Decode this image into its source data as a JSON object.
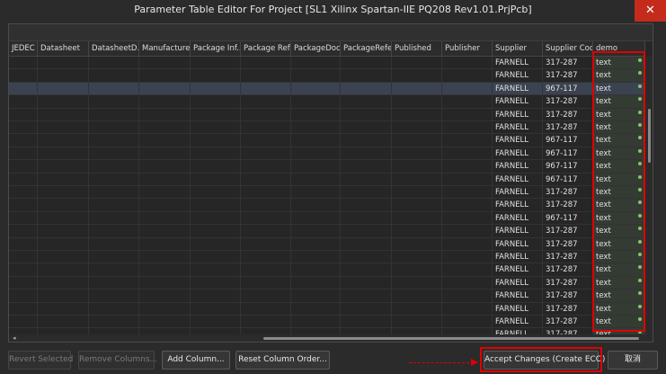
{
  "window": {
    "title": "Parameter Table Editor For Project [SL1 Xilinx Spartan-IIE PQ208 Rev1.01.PrjPcb]",
    "close_glyph": "✕"
  },
  "table": {
    "columns": [
      "JEDEC",
      "Datasheet",
      "DatasheetD...",
      "Manufacturer",
      "Package Inf...",
      "Package Ref...",
      "PackageDoc...",
      "PackageRefe...",
      "Published",
      "Publisher",
      "Supplier",
      "Supplier Code",
      "demo"
    ],
    "rows": [
      {
        "supplier": "FARNELL",
        "code": "317-287",
        "demo": "text"
      },
      {
        "supplier": "FARNELL",
        "code": "317-287",
        "demo": "text"
      },
      {
        "supplier": "FARNELL",
        "code": "967-117",
        "demo": "text",
        "selected": true
      },
      {
        "supplier": "FARNELL",
        "code": "317-287",
        "demo": "text"
      },
      {
        "supplier": "FARNELL",
        "code": "317-287",
        "demo": "text"
      },
      {
        "supplier": "FARNELL",
        "code": "317-287",
        "demo": "text"
      },
      {
        "supplier": "FARNELL",
        "code": "967-117",
        "demo": "text"
      },
      {
        "supplier": "FARNELL",
        "code": "967-117",
        "demo": "text"
      },
      {
        "supplier": "FARNELL",
        "code": "967-117",
        "demo": "text"
      },
      {
        "supplier": "FARNELL",
        "code": "967-117",
        "demo": "text"
      },
      {
        "supplier": "FARNELL",
        "code": "317-287",
        "demo": "text"
      },
      {
        "supplier": "FARNELL",
        "code": "317-287",
        "demo": "text"
      },
      {
        "supplier": "FARNELL",
        "code": "967-117",
        "demo": "text"
      },
      {
        "supplier": "FARNELL",
        "code": "317-287",
        "demo": "text"
      },
      {
        "supplier": "FARNELL",
        "code": "317-287",
        "demo": "text"
      },
      {
        "supplier": "FARNELL",
        "code": "317-287",
        "demo": "text"
      },
      {
        "supplier": "FARNELL",
        "code": "317-287",
        "demo": "text"
      },
      {
        "supplier": "FARNELL",
        "code": "317-287",
        "demo": "text"
      },
      {
        "supplier": "FARNELL",
        "code": "317-287",
        "demo": "text"
      },
      {
        "supplier": "FARNELL",
        "code": "317-287",
        "demo": "text"
      },
      {
        "supplier": "FARNELL",
        "code": "317-287",
        "demo": "text"
      },
      {
        "supplier": "FARNELL",
        "code": "317-287",
        "demo": "text"
      }
    ],
    "scroll_left_glyph": "◂"
  },
  "buttons": {
    "revert_selected": "Revert Selected",
    "remove_columns": "Remove Columns...",
    "add_column": "Add Column...",
    "reset_column_order": "Reset Column Order...",
    "accept_changes": "Accept Changes (Create ECO)",
    "cancel": "取消"
  },
  "colors": {
    "highlight": "#e00000",
    "edited_dot": "#7ec86a",
    "close_button": "#c42b1c"
  }
}
